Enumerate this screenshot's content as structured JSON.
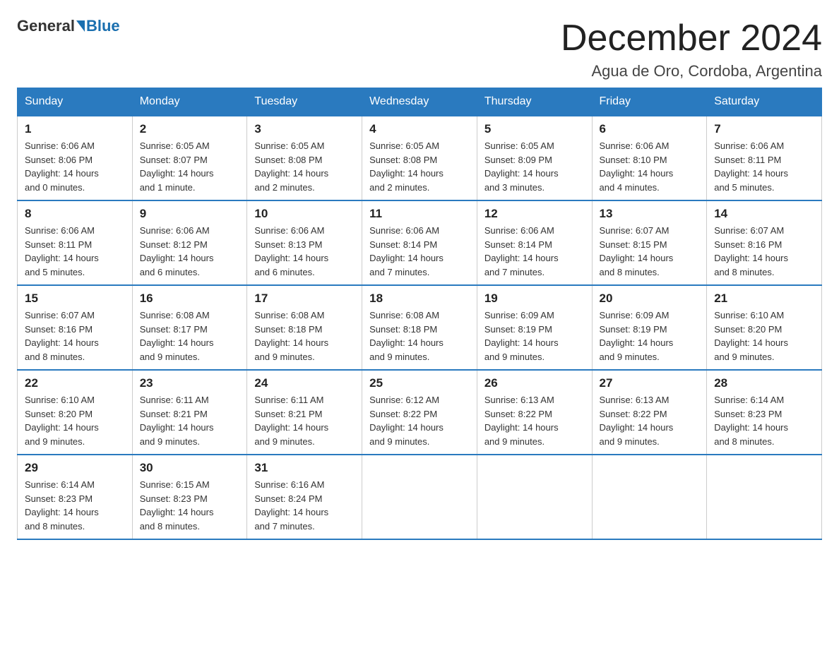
{
  "header": {
    "logo_general": "General",
    "logo_blue": "Blue",
    "month_title": "December 2024",
    "location": "Agua de Oro, Cordoba, Argentina"
  },
  "days_of_week": [
    "Sunday",
    "Monday",
    "Tuesday",
    "Wednesday",
    "Thursday",
    "Friday",
    "Saturday"
  ],
  "weeks": [
    [
      {
        "day": "1",
        "sunrise": "6:06 AM",
        "sunset": "8:06 PM",
        "daylight": "14 hours and 0 minutes."
      },
      {
        "day": "2",
        "sunrise": "6:05 AM",
        "sunset": "8:07 PM",
        "daylight": "14 hours and 1 minute."
      },
      {
        "day": "3",
        "sunrise": "6:05 AM",
        "sunset": "8:08 PM",
        "daylight": "14 hours and 2 minutes."
      },
      {
        "day": "4",
        "sunrise": "6:05 AM",
        "sunset": "8:08 PM",
        "daylight": "14 hours and 2 minutes."
      },
      {
        "day": "5",
        "sunrise": "6:05 AM",
        "sunset": "8:09 PM",
        "daylight": "14 hours and 3 minutes."
      },
      {
        "day": "6",
        "sunrise": "6:06 AM",
        "sunset": "8:10 PM",
        "daylight": "14 hours and 4 minutes."
      },
      {
        "day": "7",
        "sunrise": "6:06 AM",
        "sunset": "8:11 PM",
        "daylight": "14 hours and 5 minutes."
      }
    ],
    [
      {
        "day": "8",
        "sunrise": "6:06 AM",
        "sunset": "8:11 PM",
        "daylight": "14 hours and 5 minutes."
      },
      {
        "day": "9",
        "sunrise": "6:06 AM",
        "sunset": "8:12 PM",
        "daylight": "14 hours and 6 minutes."
      },
      {
        "day": "10",
        "sunrise": "6:06 AM",
        "sunset": "8:13 PM",
        "daylight": "14 hours and 6 minutes."
      },
      {
        "day": "11",
        "sunrise": "6:06 AM",
        "sunset": "8:14 PM",
        "daylight": "14 hours and 7 minutes."
      },
      {
        "day": "12",
        "sunrise": "6:06 AM",
        "sunset": "8:14 PM",
        "daylight": "14 hours and 7 minutes."
      },
      {
        "day": "13",
        "sunrise": "6:07 AM",
        "sunset": "8:15 PM",
        "daylight": "14 hours and 8 minutes."
      },
      {
        "day": "14",
        "sunrise": "6:07 AM",
        "sunset": "8:16 PM",
        "daylight": "14 hours and 8 minutes."
      }
    ],
    [
      {
        "day": "15",
        "sunrise": "6:07 AM",
        "sunset": "8:16 PM",
        "daylight": "14 hours and 8 minutes."
      },
      {
        "day": "16",
        "sunrise": "6:08 AM",
        "sunset": "8:17 PM",
        "daylight": "14 hours and 9 minutes."
      },
      {
        "day": "17",
        "sunrise": "6:08 AM",
        "sunset": "8:18 PM",
        "daylight": "14 hours and 9 minutes."
      },
      {
        "day": "18",
        "sunrise": "6:08 AM",
        "sunset": "8:18 PM",
        "daylight": "14 hours and 9 minutes."
      },
      {
        "day": "19",
        "sunrise": "6:09 AM",
        "sunset": "8:19 PM",
        "daylight": "14 hours and 9 minutes."
      },
      {
        "day": "20",
        "sunrise": "6:09 AM",
        "sunset": "8:19 PM",
        "daylight": "14 hours and 9 minutes."
      },
      {
        "day": "21",
        "sunrise": "6:10 AM",
        "sunset": "8:20 PM",
        "daylight": "14 hours and 9 minutes."
      }
    ],
    [
      {
        "day": "22",
        "sunrise": "6:10 AM",
        "sunset": "8:20 PM",
        "daylight": "14 hours and 9 minutes."
      },
      {
        "day": "23",
        "sunrise": "6:11 AM",
        "sunset": "8:21 PM",
        "daylight": "14 hours and 9 minutes."
      },
      {
        "day": "24",
        "sunrise": "6:11 AM",
        "sunset": "8:21 PM",
        "daylight": "14 hours and 9 minutes."
      },
      {
        "day": "25",
        "sunrise": "6:12 AM",
        "sunset": "8:22 PM",
        "daylight": "14 hours and 9 minutes."
      },
      {
        "day": "26",
        "sunrise": "6:13 AM",
        "sunset": "8:22 PM",
        "daylight": "14 hours and 9 minutes."
      },
      {
        "day": "27",
        "sunrise": "6:13 AM",
        "sunset": "8:22 PM",
        "daylight": "14 hours and 9 minutes."
      },
      {
        "day": "28",
        "sunrise": "6:14 AM",
        "sunset": "8:23 PM",
        "daylight": "14 hours and 8 minutes."
      }
    ],
    [
      {
        "day": "29",
        "sunrise": "6:14 AM",
        "sunset": "8:23 PM",
        "daylight": "14 hours and 8 minutes."
      },
      {
        "day": "30",
        "sunrise": "6:15 AM",
        "sunset": "8:23 PM",
        "daylight": "14 hours and 8 minutes."
      },
      {
        "day": "31",
        "sunrise": "6:16 AM",
        "sunset": "8:24 PM",
        "daylight": "14 hours and 7 minutes."
      },
      null,
      null,
      null,
      null
    ]
  ],
  "labels": {
    "sunrise": "Sunrise:",
    "sunset": "Sunset:",
    "daylight": "Daylight:"
  }
}
